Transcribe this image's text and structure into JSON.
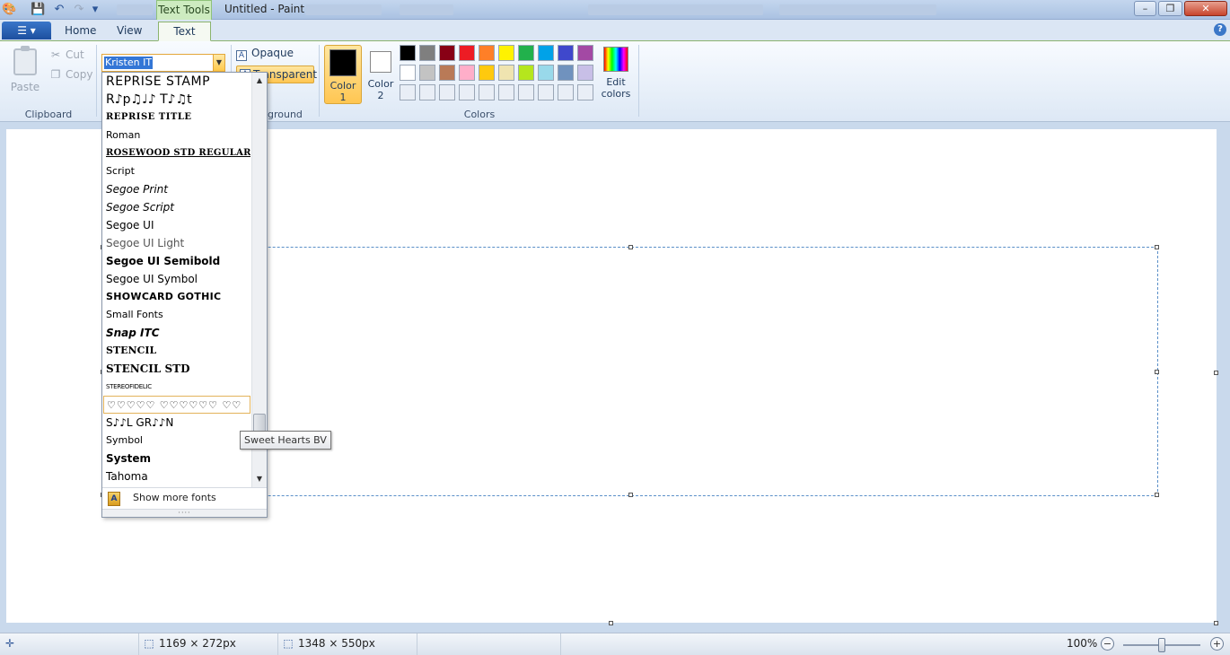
{
  "titlebar": {
    "app_title": "Untitled - Paint",
    "contextual_tab": "Text Tools",
    "quick_access": [
      "paint-app-icon",
      "save-icon",
      "undo-icon",
      "redo-icon",
      "customize-dropdown-icon"
    ],
    "window_controls": {
      "minimize": "–",
      "maximize": "❐",
      "close": "✕"
    }
  },
  "tabs": {
    "file": "☰ ▾",
    "items": [
      {
        "label": "Home",
        "active": false
      },
      {
        "label": "View",
        "active": false
      },
      {
        "label": "Text",
        "active": true
      }
    ],
    "help": "?"
  },
  "ribbon": {
    "clipboard": {
      "paste": "Paste",
      "cut": "Cut",
      "copy": "Copy",
      "group_label": "Clipboard"
    },
    "font": {
      "current_font": "Kristen ITC"
    },
    "background": {
      "opaque": "Opaque",
      "transparent": "Transparent",
      "group_label_visible": "ground"
    },
    "colors": {
      "color1_label": "Color 1",
      "color1_line1": "Color",
      "color1_line2": "1",
      "color1_value": "#000000",
      "color2_line1": "Color",
      "color2_line2": "2",
      "color2_value": "#ffffff",
      "edit_line1": "Edit",
      "edit_line2": "colors",
      "group_label": "Colors",
      "palette_row1": [
        "#000000",
        "#7f7f7f",
        "#880015",
        "#ed1c24",
        "#ff7f27",
        "#fff200",
        "#22b14c",
        "#00a2e8",
        "#3f48cc",
        "#a349a4"
      ],
      "palette_row2": [
        "#ffffff",
        "#c3c3c3",
        "#b97a57",
        "#ffaec9",
        "#ffc90e",
        "#efe4b0",
        "#b5e61d",
        "#99d9ea",
        "#7092be",
        "#c8bfe7"
      ],
      "palette_row3": [
        "#e9eef6",
        "#e9eef6",
        "#e9eef6",
        "#e9eef6",
        "#e9eef6",
        "#e9eef6",
        "#e9eef6",
        "#e9eef6",
        "#e9eef6",
        "#e9eef6"
      ]
    }
  },
  "font_dropdown": {
    "fonts": [
      {
        "name": "REPRISE STAMP",
        "style": "font-size:14px; letter-spacing:0.5px;"
      },
      {
        "name": "R♪p♫♩♪ T♪♫t",
        "style": "font-size:14px;"
      },
      {
        "name": "REPRISE TITLE",
        "style": "font-family:'DejaVu Serif',serif; font-size:10px; font-weight:bold; letter-spacing:0.5px;"
      },
      {
        "name": "Roman",
        "style": "font-size:11px;"
      },
      {
        "name": "ROSEWOOD STD REGULAR",
        "style": "font-family:'DejaVu Serif',serif; font-size:10px; font-weight:bold; text-decoration:underline; letter-spacing:0.3px;"
      },
      {
        "name": "Script",
        "style": "font-size:11px;"
      },
      {
        "name": "Segoe Print",
        "style": "font-size:12px; font-style:italic;"
      },
      {
        "name": "Segoe Script",
        "style": "font-size:12px; font-style:italic;"
      },
      {
        "name": "Segoe UI",
        "style": "font-size:12px;"
      },
      {
        "name": "Segoe UI Light",
        "style": "font-size:12px; color:#555;"
      },
      {
        "name": "Segoe UI Semibold",
        "style": "font-size:12px; font-weight:600;"
      },
      {
        "name": "Segoe UI Symbol",
        "style": "font-size:12px;"
      },
      {
        "name": "SHOWCARD GOTHIC",
        "style": "font-size:11px; font-weight:900; letter-spacing:0.3px;"
      },
      {
        "name": "Small Fonts",
        "style": "font-size:11px;"
      },
      {
        "name": "Snap ITC",
        "style": "font-size:12px; font-weight:900; font-style:italic;"
      },
      {
        "name": "STENCIL",
        "style": "font-family:'DejaVu Serif',serif; font-size:11px; font-weight:bold;"
      },
      {
        "name": "STENCIL STD",
        "style": "font-family:'DejaVu Serif',serif; font-size:12px; font-weight:bold;"
      },
      {
        "name": "STEREOFIDELIC",
        "style": "font-size:7px; letter-spacing:-0.3px;"
      },
      {
        "name": "♡♡♡♡♡ ♡♡♡♡♡♡ ♡♡",
        "style": "font-size:11px; letter-spacing:1px;",
        "hover": true
      },
      {
        "name": "S♪♪L GR♪♪N",
        "style": "font-size:12px;"
      },
      {
        "name": "Symbol",
        "style": "font-size:11px;"
      },
      {
        "name": "System",
        "style": "font-size:12px; font-weight:bold;"
      },
      {
        "name": "Tahoma",
        "style": "font-size:12px;"
      }
    ],
    "show_more": "Show more fonts",
    "grip": "····"
  },
  "tooltip": "Sweet Hearts BV",
  "statusbar": {
    "selection_size": "1169 × 272px",
    "canvas_size": "1348 × 550px",
    "zoom": "100%"
  }
}
